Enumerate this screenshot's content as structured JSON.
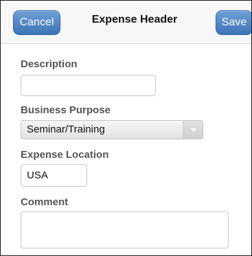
{
  "header": {
    "cancel_label": "Cancel",
    "title": "Expense Header",
    "save_label": "Save"
  },
  "form": {
    "description": {
      "label": "Description",
      "value": ""
    },
    "business_purpose": {
      "label": "Business Purpose",
      "selected": "Seminar/Training"
    },
    "expense_location": {
      "label": "Expense Location",
      "value": "USA"
    },
    "comment": {
      "label": "Comment",
      "value": ""
    }
  },
  "icons": {
    "select_arrow": "chevron-down-icon"
  }
}
